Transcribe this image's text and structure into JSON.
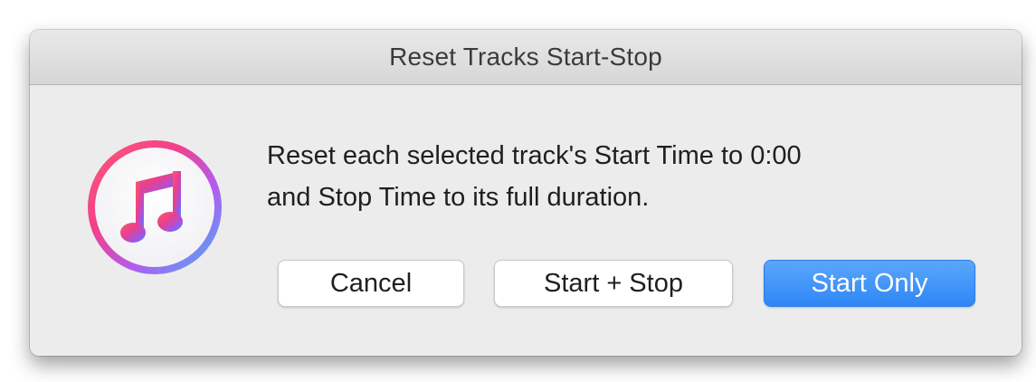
{
  "dialog": {
    "title": "Reset Tracks Start-Stop",
    "app_icon": "itunes-music-note-icon",
    "message_lines": [
      "Reset each selected track's Start Time to 0:00",
      "and Stop Time to its full duration."
    ],
    "buttons": {
      "cancel": "Cancel",
      "start_stop": "Start + Stop",
      "start_only": "Start Only"
    }
  },
  "colors": {
    "default_button": "#2f86f6",
    "dialog_background": "#ececec"
  }
}
